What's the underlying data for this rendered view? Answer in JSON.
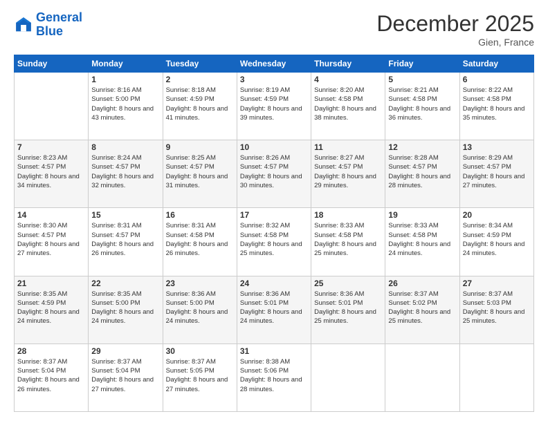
{
  "header": {
    "logo_line1": "General",
    "logo_line2": "Blue",
    "month_title": "December 2025",
    "location": "Gien, France"
  },
  "weekdays": [
    "Sunday",
    "Monday",
    "Tuesday",
    "Wednesday",
    "Thursday",
    "Friday",
    "Saturday"
  ],
  "weeks": [
    [
      {
        "day": "",
        "empty": true
      },
      {
        "day": "1",
        "sunrise": "8:16 AM",
        "sunset": "5:00 PM",
        "daylight": "8 hours and 43 minutes."
      },
      {
        "day": "2",
        "sunrise": "8:18 AM",
        "sunset": "4:59 PM",
        "daylight": "8 hours and 41 minutes."
      },
      {
        "day": "3",
        "sunrise": "8:19 AM",
        "sunset": "4:59 PM",
        "daylight": "8 hours and 39 minutes."
      },
      {
        "day": "4",
        "sunrise": "8:20 AM",
        "sunset": "4:58 PM",
        "daylight": "8 hours and 38 minutes."
      },
      {
        "day": "5",
        "sunrise": "8:21 AM",
        "sunset": "4:58 PM",
        "daylight": "8 hours and 36 minutes."
      },
      {
        "day": "6",
        "sunrise": "8:22 AM",
        "sunset": "4:58 PM",
        "daylight": "8 hours and 35 minutes."
      }
    ],
    [
      {
        "day": "7",
        "sunrise": "8:23 AM",
        "sunset": "4:57 PM",
        "daylight": "8 hours and 34 minutes."
      },
      {
        "day": "8",
        "sunrise": "8:24 AM",
        "sunset": "4:57 PM",
        "daylight": "8 hours and 32 minutes."
      },
      {
        "day": "9",
        "sunrise": "8:25 AM",
        "sunset": "4:57 PM",
        "daylight": "8 hours and 31 minutes."
      },
      {
        "day": "10",
        "sunrise": "8:26 AM",
        "sunset": "4:57 PM",
        "daylight": "8 hours and 30 minutes."
      },
      {
        "day": "11",
        "sunrise": "8:27 AM",
        "sunset": "4:57 PM",
        "daylight": "8 hours and 29 minutes."
      },
      {
        "day": "12",
        "sunrise": "8:28 AM",
        "sunset": "4:57 PM",
        "daylight": "8 hours and 28 minutes."
      },
      {
        "day": "13",
        "sunrise": "8:29 AM",
        "sunset": "4:57 PM",
        "daylight": "8 hours and 27 minutes."
      }
    ],
    [
      {
        "day": "14",
        "sunrise": "8:30 AM",
        "sunset": "4:57 PM",
        "daylight": "8 hours and 27 minutes."
      },
      {
        "day": "15",
        "sunrise": "8:31 AM",
        "sunset": "4:57 PM",
        "daylight": "8 hours and 26 minutes."
      },
      {
        "day": "16",
        "sunrise": "8:31 AM",
        "sunset": "4:58 PM",
        "daylight": "8 hours and 26 minutes."
      },
      {
        "day": "17",
        "sunrise": "8:32 AM",
        "sunset": "4:58 PM",
        "daylight": "8 hours and 25 minutes."
      },
      {
        "day": "18",
        "sunrise": "8:33 AM",
        "sunset": "4:58 PM",
        "daylight": "8 hours and 25 minutes."
      },
      {
        "day": "19",
        "sunrise": "8:33 AM",
        "sunset": "4:58 PM",
        "daylight": "8 hours and 24 minutes."
      },
      {
        "day": "20",
        "sunrise": "8:34 AM",
        "sunset": "4:59 PM",
        "daylight": "8 hours and 24 minutes."
      }
    ],
    [
      {
        "day": "21",
        "sunrise": "8:35 AM",
        "sunset": "4:59 PM",
        "daylight": "8 hours and 24 minutes."
      },
      {
        "day": "22",
        "sunrise": "8:35 AM",
        "sunset": "5:00 PM",
        "daylight": "8 hours and 24 minutes."
      },
      {
        "day": "23",
        "sunrise": "8:36 AM",
        "sunset": "5:00 PM",
        "daylight": "8 hours and 24 minutes."
      },
      {
        "day": "24",
        "sunrise": "8:36 AM",
        "sunset": "5:01 PM",
        "daylight": "8 hours and 24 minutes."
      },
      {
        "day": "25",
        "sunrise": "8:36 AM",
        "sunset": "5:01 PM",
        "daylight": "8 hours and 25 minutes."
      },
      {
        "day": "26",
        "sunrise": "8:37 AM",
        "sunset": "5:02 PM",
        "daylight": "8 hours and 25 minutes."
      },
      {
        "day": "27",
        "sunrise": "8:37 AM",
        "sunset": "5:03 PM",
        "daylight": "8 hours and 25 minutes."
      }
    ],
    [
      {
        "day": "28",
        "sunrise": "8:37 AM",
        "sunset": "5:04 PM",
        "daylight": "8 hours and 26 minutes."
      },
      {
        "day": "29",
        "sunrise": "8:37 AM",
        "sunset": "5:04 PM",
        "daylight": "8 hours and 27 minutes."
      },
      {
        "day": "30",
        "sunrise": "8:37 AM",
        "sunset": "5:05 PM",
        "daylight": "8 hours and 27 minutes."
      },
      {
        "day": "31",
        "sunrise": "8:38 AM",
        "sunset": "5:06 PM",
        "daylight": "8 hours and 28 minutes."
      },
      {
        "day": "",
        "empty": true
      },
      {
        "day": "",
        "empty": true
      },
      {
        "day": "",
        "empty": true
      }
    ]
  ],
  "labels": {
    "sunrise": "Sunrise:",
    "sunset": "Sunset:",
    "daylight": "Daylight:"
  }
}
